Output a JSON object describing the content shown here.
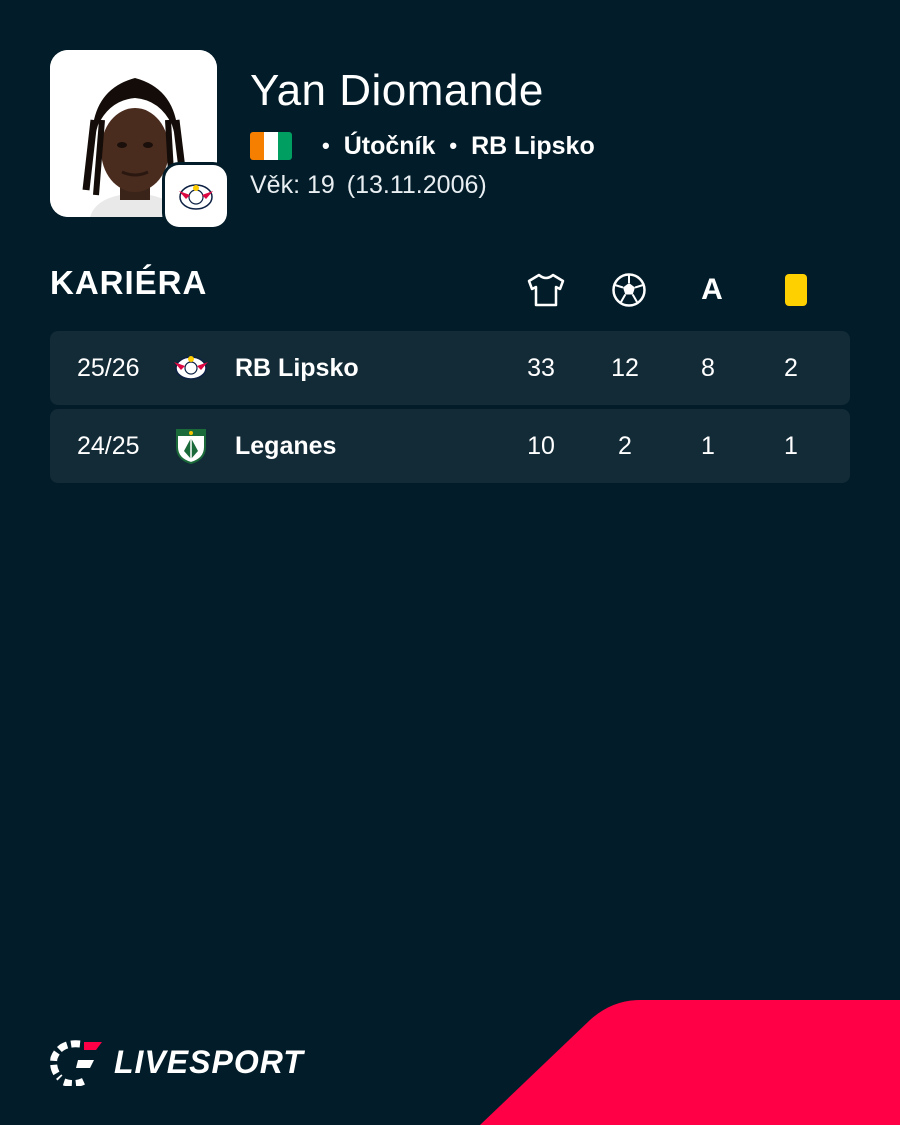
{
  "player": {
    "name": "Yan Diomande",
    "position": "Útočník",
    "club": "RB Lipsko",
    "age_label": "Věk: 19",
    "birth_date": "(13.11.2006)",
    "nationality_flag_colors": [
      "#f77f00",
      "#ffffff",
      "#009e60"
    ]
  },
  "career": {
    "title": "KARIÉRA",
    "columns": [
      {
        "icon": "jersey-icon"
      },
      {
        "icon": "ball-icon"
      },
      {
        "icon": "assist-icon",
        "label": "A"
      },
      {
        "icon": "yellow-card-icon"
      }
    ],
    "rows": [
      {
        "season": "25/26",
        "club": "RB Lipsko",
        "logo": "rb-leipzig-logo",
        "apps": "33",
        "goals": "12",
        "assists": "8",
        "yellow": "2"
      },
      {
        "season": "24/25",
        "club": "Leganes",
        "logo": "leganes-logo",
        "apps": "10",
        "goals": "2",
        "assists": "1",
        "yellow": "1"
      }
    ]
  },
  "brand": {
    "name": "LIVESPORT",
    "accent": "#ff0046"
  },
  "colors": {
    "background": "#021d29",
    "row_background": "#132b37",
    "yellow_card": "#ffd000"
  }
}
